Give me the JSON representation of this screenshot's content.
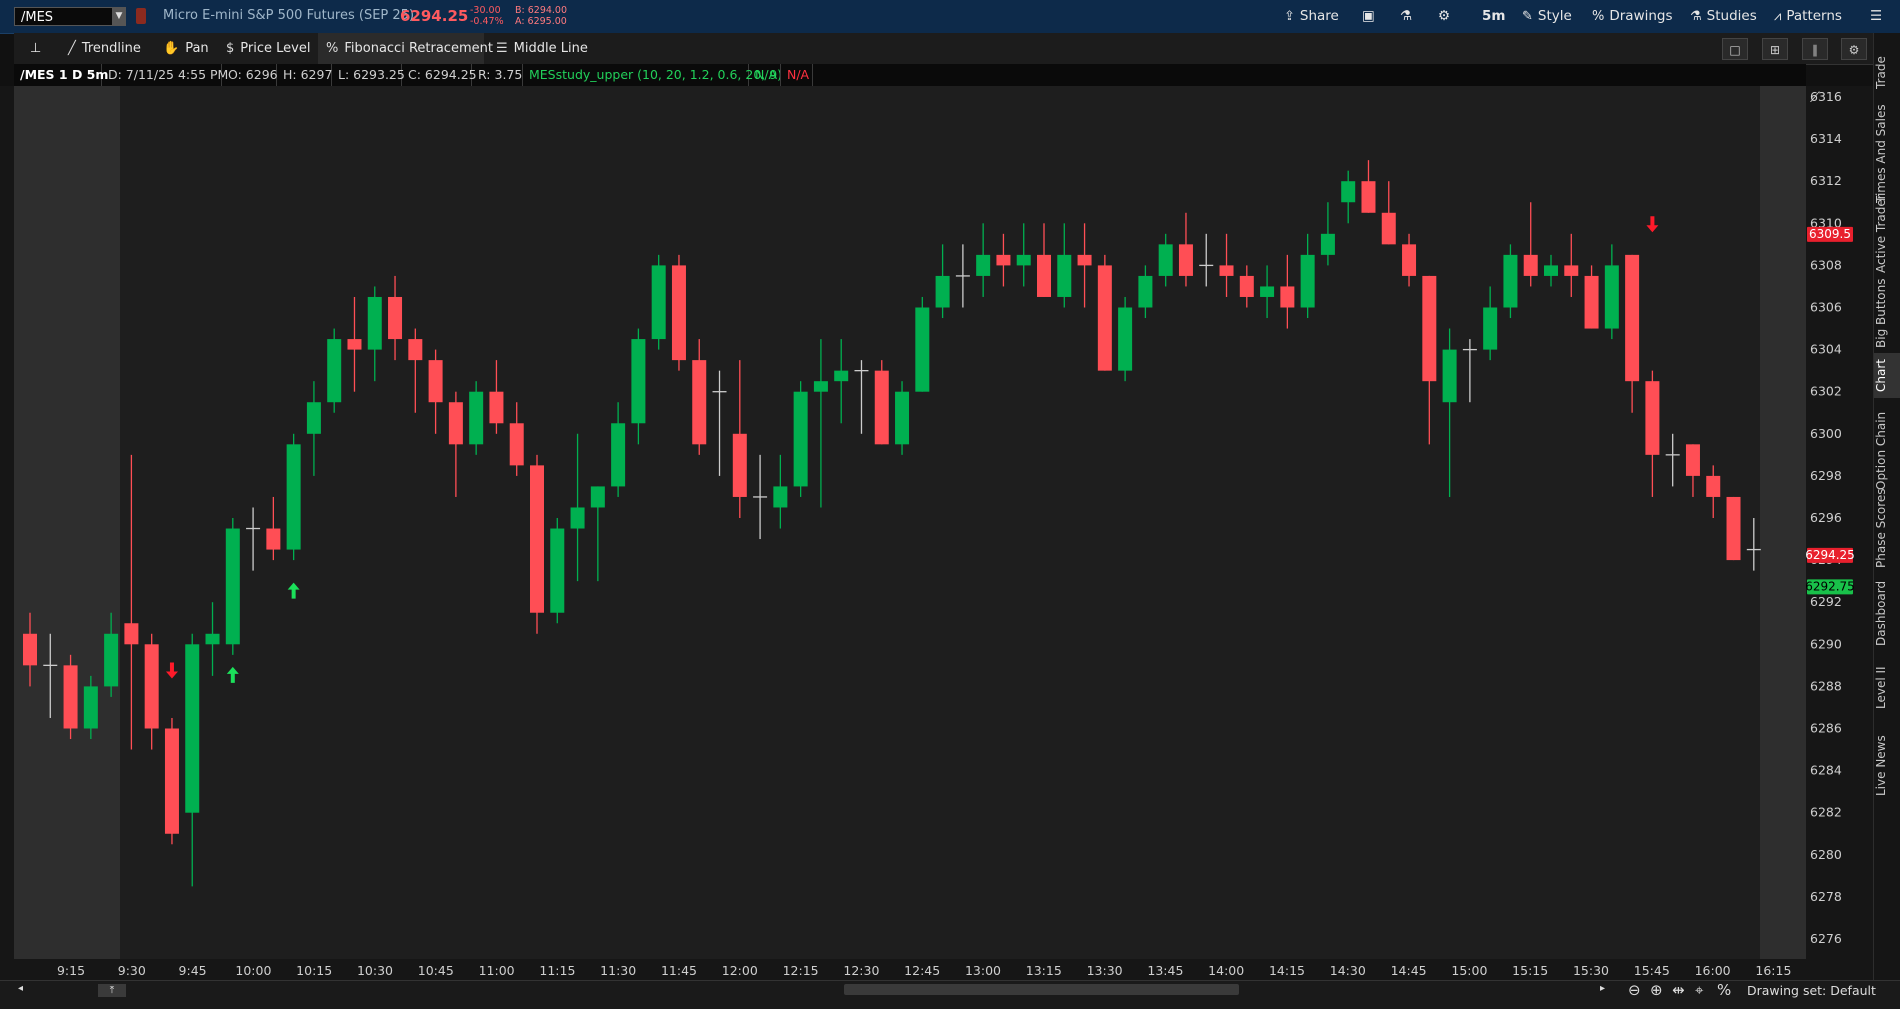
{
  "header": {
    "symbol": "/MES",
    "description": "Micro E-mini S&P 500 Futures (SEP 25)",
    "last_price": "6294.25",
    "net_change": "-30.00",
    "pct_change": "-0.47%",
    "bid": "B: 6294.00",
    "ask": "A: 6295.00",
    "buttons": {
      "share": "Share",
      "timeframe": "5m",
      "style": "Style",
      "drawings": "Drawings",
      "studies": "Studies",
      "patterns": "Patterns"
    }
  },
  "drawing_toolbar": {
    "trendline": "Trendline",
    "pan": "Pan",
    "price_level": "Price Level",
    "fibonacci": "Fibonacci Retracement",
    "middle_line": "Middle Line"
  },
  "info_bar": {
    "symbol_period": "/MES 1 D 5m",
    "date": "D: 7/11/25 4:55 PM",
    "open": "O: 6296",
    "high": "H: 6297",
    "low": "L: 6293.25",
    "close": "C: 6294.25",
    "range": "R: 3.75",
    "study": "MESstudy_upper (10, 20, 1.2, 0.6, 20, 9)",
    "na_green": "N/A",
    "na_red": "N/A"
  },
  "price_labels": {
    "marker_high": "6309.5",
    "marker_last": "6294.25",
    "marker_bid": "6292.75"
  },
  "colors": {
    "up": "#00b050",
    "down": "#ff4e55",
    "neutral": "#cccccc",
    "chart_bg": "#1e1e1e",
    "shade_bg": "#2e2e2e"
  },
  "side_tabs": [
    "Trade",
    "Times And Sales",
    "Active Trader",
    "Big Buttons",
    "Chart",
    "Option Chain",
    "Phase Scores",
    "Dashboard",
    "Level II",
    "Live News"
  ],
  "bottom": {
    "drawing_set": "Drawing set: Default"
  },
  "chart_data": {
    "type": "candlestick",
    "interval": "5m",
    "y_ticks": [
      6276,
      6278,
      6280,
      6282,
      6284,
      6286,
      6288,
      6290,
      6292,
      6294,
      6296,
      6298,
      6300,
      6302,
      6304,
      6306,
      6308,
      6310,
      6312,
      6314,
      6316
    ],
    "ylim": [
      6275,
      6317
    ],
    "x_ticks": [
      "9:15",
      "9:30",
      "9:45",
      "10:00",
      "10:15",
      "10:30",
      "10:45",
      "11:00",
      "11:15",
      "11:30",
      "11:45",
      "12:00",
      "12:15",
      "12:30",
      "12:45",
      "13:00",
      "13:15",
      "13:30",
      "13:45",
      "14:00",
      "14:15",
      "14:30",
      "14:45",
      "15:00",
      "15:15",
      "15:30",
      "15:45",
      "16:00",
      "16:15"
    ],
    "first_bar_offset": -5,
    "candles": [
      [
        6290.5,
        6291.5,
        6288,
        6289
      ],
      [
        6289,
        6290.5,
        6286.5,
        6289
      ],
      [
        6289,
        6289.5,
        6285.5,
        6286
      ],
      [
        6286,
        6288.5,
        6285.5,
        6288
      ],
      [
        6288,
        6291.5,
        6287.5,
        6290.5
      ],
      [
        6291,
        6299,
        6285,
        6290
      ],
      [
        6290,
        6290.5,
        6285,
        6286
      ],
      [
        6286,
        6286.5,
        6280.5,
        6281
      ],
      [
        6282,
        6290.5,
        6278.5,
        6290
      ],
      [
        6290,
        6292,
        6288.5,
        6290.5
      ],
      [
        6290,
        6296,
        6289.5,
        6295.5
      ],
      [
        6295.5,
        6296.5,
        6293.5,
        6295.5
      ],
      [
        6295.5,
        6297,
        6294,
        6294.5
      ],
      [
        6294.5,
        6300,
        6294,
        6299.5
      ],
      [
        6300,
        6302.5,
        6298,
        6301.5
      ],
      [
        6301.5,
        6305,
        6301,
        6304.5
      ],
      [
        6304.5,
        6306.5,
        6302,
        6304
      ],
      [
        6304,
        6307,
        6302.5,
        6306.5
      ],
      [
        6306.5,
        6307.5,
        6303.5,
        6304.5
      ],
      [
        6304.5,
        6305,
        6301,
        6303.5
      ],
      [
        6303.5,
        6304,
        6300,
        6301.5
      ],
      [
        6301.5,
        6302,
        6297,
        6299.5
      ],
      [
        6299.5,
        6302.5,
        6299,
        6302
      ],
      [
        6302,
        6303.5,
        6300,
        6300.5
      ],
      [
        6300.5,
        6301.5,
        6298,
        6298.5
      ],
      [
        6298.5,
        6299,
        6290.5,
        6291.5
      ],
      [
        6291.5,
        6296,
        6291,
        6295.5
      ],
      [
        6295.5,
        6300,
        6293,
        6296.5
      ],
      [
        6296.5,
        6297.5,
        6293,
        6297.5
      ],
      [
        6297.5,
        6301.5,
        6297,
        6300.5
      ],
      [
        6300.5,
        6305,
        6299.5,
        6304.5
      ],
      [
        6304.5,
        6308.5,
        6304,
        6308
      ],
      [
        6308,
        6308.5,
        6303,
        6303.5
      ],
      [
        6303.5,
        6304.5,
        6299,
        6299.5
      ],
      [
        6302,
        6303,
        6298,
        6302
      ],
      [
        6300,
        6303.5,
        6296,
        6297
      ],
      [
        6297,
        6299,
        6295,
        6297
      ],
      [
        6296.5,
        6299,
        6295.5,
        6297.5
      ],
      [
        6297.5,
        6302.5,
        6297,
        6302
      ],
      [
        6302,
        6304.5,
        6296.5,
        6302.5
      ],
      [
        6302.5,
        6304.5,
        6300.5,
        6303
      ],
      [
        6303,
        6303.5,
        6300,
        6303
      ],
      [
        6303,
        6303.5,
        6299.5,
        6299.5
      ],
      [
        6299.5,
        6302.5,
        6299,
        6302
      ],
      [
        6302,
        6306.5,
        6302,
        6306
      ],
      [
        6306,
        6309,
        6305.5,
        6307.5
      ],
      [
        6307.5,
        6309,
        6306,
        6307.5
      ],
      [
        6307.5,
        6310,
        6306.5,
        6308.5
      ],
      [
        6308.5,
        6309.5,
        6307,
        6308
      ],
      [
        6308,
        6310,
        6307,
        6308.5
      ],
      [
        6308.5,
        6310,
        6306.5,
        6306.5
      ],
      [
        6306.5,
        6310,
        6306,
        6308.5
      ],
      [
        6308.5,
        6310,
        6306,
        6308
      ],
      [
        6308,
        6308.5,
        6303,
        6303
      ],
      [
        6303,
        6306.5,
        6302.5,
        6306
      ],
      [
        6306,
        6308,
        6305.5,
        6307.5
      ],
      [
        6307.5,
        6309.5,
        6307,
        6309
      ],
      [
        6309,
        6310.5,
        6307,
        6307.5
      ],
      [
        6308,
        6309.5,
        6307,
        6308
      ],
      [
        6308,
        6309.5,
        6306.5,
        6307.5
      ],
      [
        6307.5,
        6308,
        6306,
        6306.5
      ],
      [
        6306.5,
        6308,
        6305.5,
        6307
      ],
      [
        6307,
        6308.5,
        6305,
        6306
      ],
      [
        6306,
        6309.5,
        6305.5,
        6308.5
      ],
      [
        6308.5,
        6311,
        6308,
        6309.5
      ],
      [
        6311,
        6312.5,
        6310,
        6312
      ],
      [
        6312,
        6313,
        6310.5,
        6310.5
      ],
      [
        6310.5,
        6312,
        6309,
        6309
      ],
      [
        6309,
        6309.5,
        6307,
        6307.5
      ],
      [
        6307.5,
        6307.5,
        6299.5,
        6302.5
      ],
      [
        6301.5,
        6305,
        6297,
        6304
      ],
      [
        6304,
        6304.5,
        6301.5,
        6304
      ],
      [
        6304,
        6307,
        6303.5,
        6306
      ],
      [
        6306,
        6309,
        6305.5,
        6308.5
      ],
      [
        6308.5,
        6311,
        6307,
        6307.5
      ],
      [
        6307.5,
        6308.5,
        6307,
        6308
      ],
      [
        6308,
        6309.5,
        6306.5,
        6307.5
      ],
      [
        6307.5,
        6308,
        6305,
        6305
      ],
      [
        6305,
        6309,
        6304.5,
        6308
      ],
      [
        6308.5,
        6308.5,
        6301,
        6302.5
      ],
      [
        6302.5,
        6303,
        6297,
        6299
      ],
      [
        6299,
        6300,
        6297.5,
        6299
      ],
      [
        6299.5,
        6299.5,
        6297,
        6298
      ],
      [
        6298,
        6298.5,
        6296,
        6297
      ],
      [
        6297,
        6297,
        6294,
        6294
      ],
      [
        6294.5,
        6296,
        6293.5,
        6294.5
      ]
    ],
    "signals": [
      {
        "bar": 7,
        "dir": "down",
        "price": 6288.8
      },
      {
        "bar": 10,
        "dir": "up",
        "price": 6288.5
      },
      {
        "bar": 13,
        "dir": "up",
        "price": 6292.5
      },
      {
        "bar": 80,
        "dir": "down",
        "price": 6310
      }
    ]
  }
}
